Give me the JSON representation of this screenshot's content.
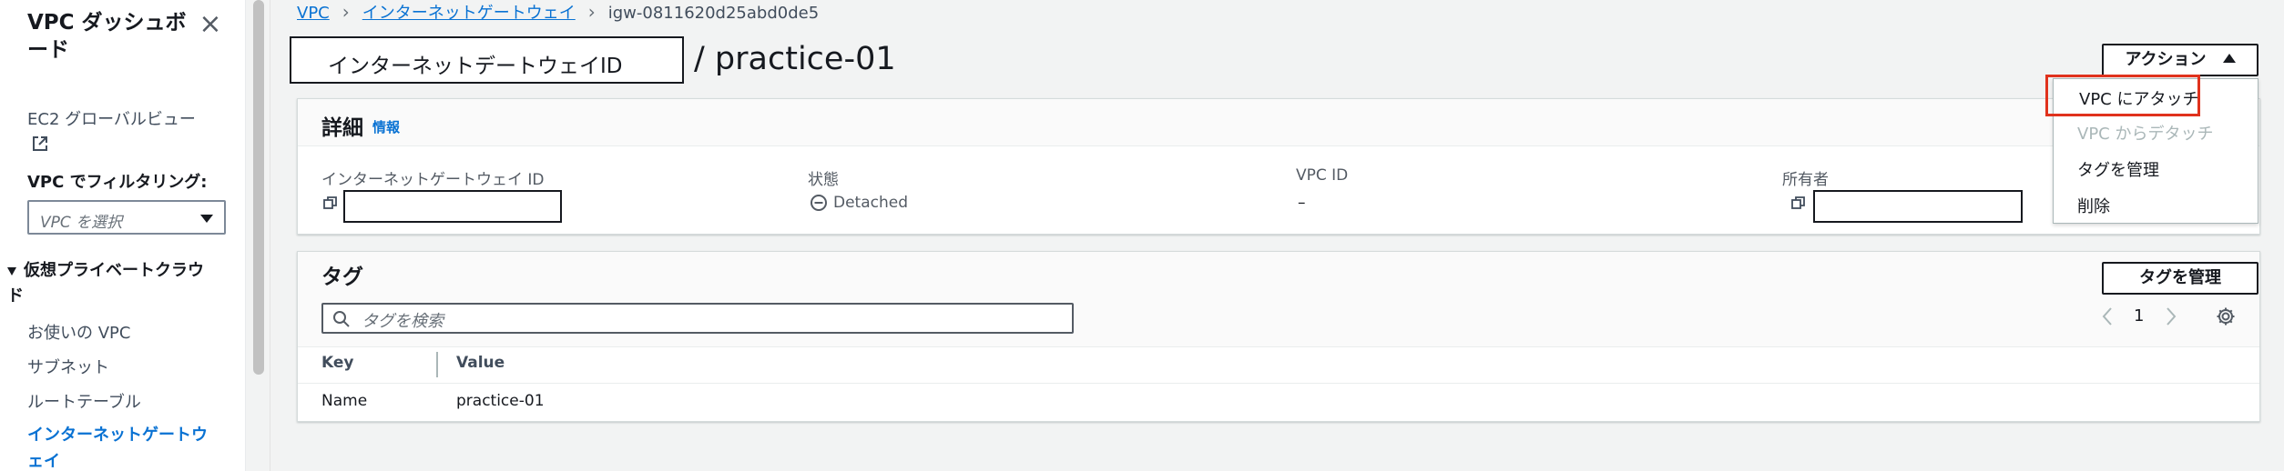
{
  "sidebar": {
    "title": "VPC ダッシュボード",
    "global_view_link": "EC2 グローバルビュー",
    "filter_label": "VPC でフィルタリング:",
    "filter_placeholder": "VPC を選択",
    "section": "仮想プライベートクラウド",
    "items": [
      {
        "label": "お使いの VPC"
      },
      {
        "label": "サブネット"
      },
      {
        "label": "ルートテーブル"
      },
      {
        "label": "インターネットゲートウェイ",
        "active": true
      }
    ]
  },
  "breadcrumb": {
    "root": "VPC",
    "parent": "インターネットゲートウェイ",
    "current": "igw-0811620d25abd0de5"
  },
  "header": {
    "id_label": "インターネットデートウェイID",
    "title_suffix": "/ practice-01",
    "actions_label": "アクション"
  },
  "actions_menu": {
    "items": [
      {
        "label": "VPC にアタッチ",
        "disabled": false,
        "highlighted": true
      },
      {
        "label": "VPC からデタッチ",
        "disabled": true
      },
      {
        "label": "タグを管理",
        "disabled": false
      },
      {
        "label": "削除",
        "disabled": false
      }
    ]
  },
  "details": {
    "title": "詳細",
    "info": "情報",
    "fields": {
      "igw_id_label": "インターネットゲートウェイ ID",
      "state_label": "状態",
      "state_value": "Detached",
      "vpc_id_label": "VPC ID",
      "vpc_id_value": "–",
      "owner_label": "所有者"
    }
  },
  "tags": {
    "title": "タグ",
    "manage_label": "タグを管理",
    "search_placeholder": "タグを検索",
    "page": "1",
    "columns": [
      "Key",
      "Value"
    ],
    "rows": [
      {
        "key": "Name",
        "value": "practice-01"
      }
    ]
  },
  "colors": {
    "link": "#0972d3",
    "highlight_border": "#e0321d",
    "text": "#16191f"
  }
}
